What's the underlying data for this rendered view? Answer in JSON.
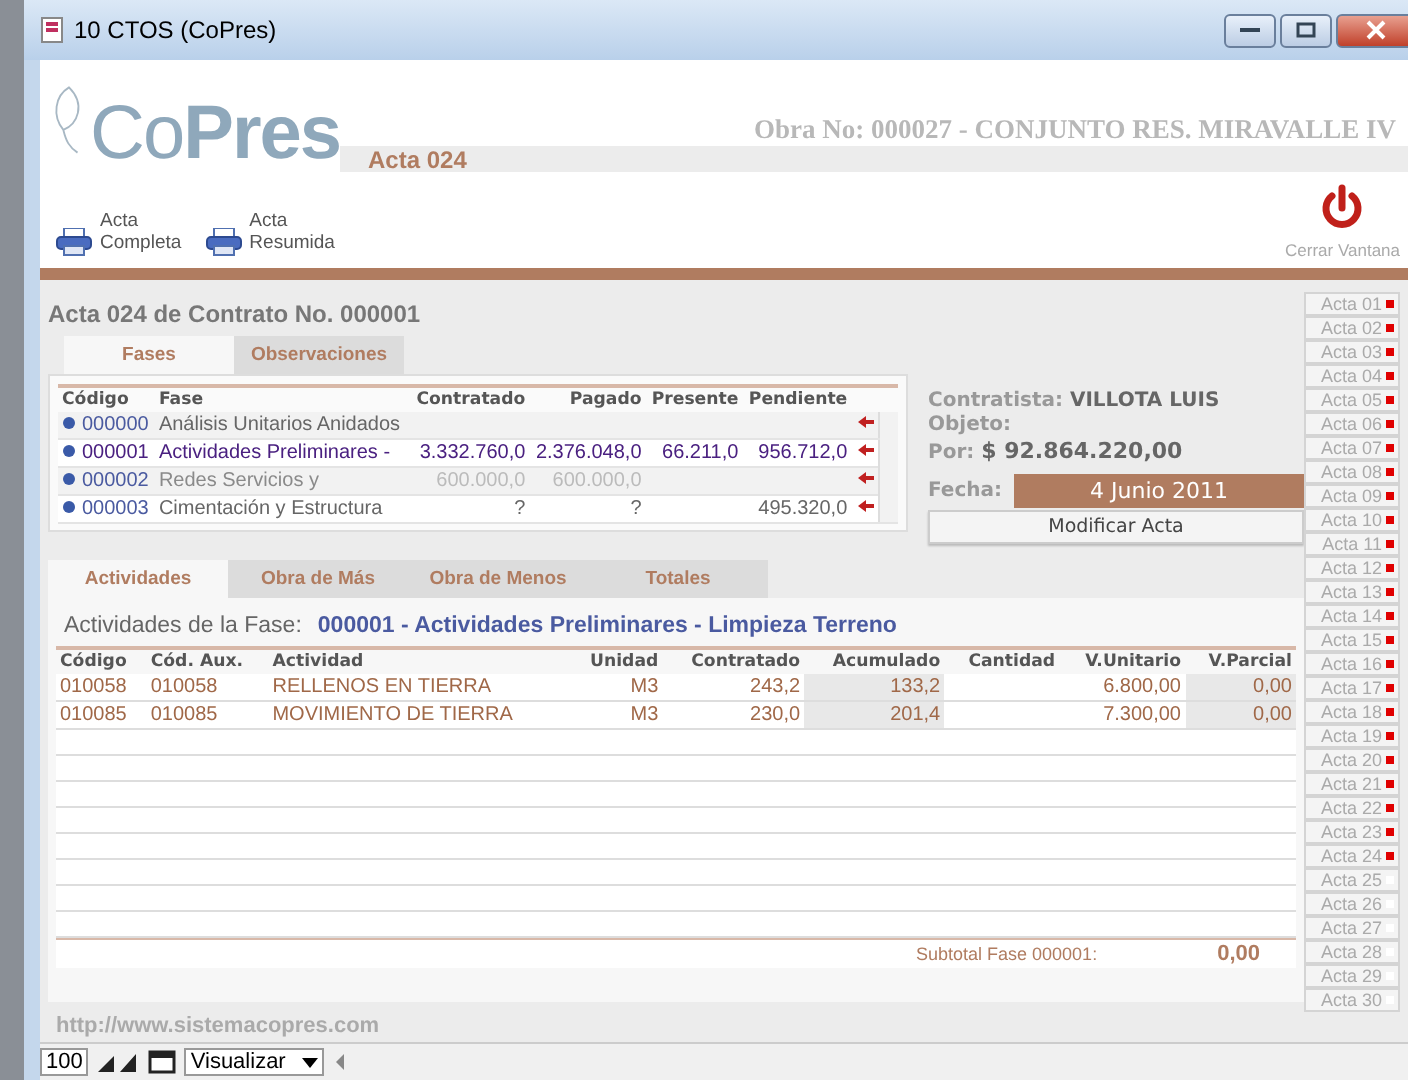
{
  "window": {
    "title": "10 CTOS (CoPres)"
  },
  "header": {
    "logo": "Co**Pres**",
    "acta": "Acta 024",
    "obra": "Obra No: 000027 - CONJUNTO RES. MIRAVALLE IV",
    "print_buttons": [
      {
        "line1": "Acta",
        "line2": "Completa"
      },
      {
        "line1": "Acta",
        "line2": "Resumida"
      }
    ],
    "close_label": "Cerrar Vantana"
  },
  "contract_title": "Acta 024 de Contrato No. 000001",
  "top_tabs": [
    {
      "label": "Fases",
      "selected": true
    },
    {
      "label": "Observaciones",
      "selected": false
    }
  ],
  "fases": {
    "columns": [
      "Código",
      "Fase",
      "Contratado",
      "Pagado",
      "Presente",
      "Pendiente"
    ],
    "rows": [
      {
        "codigo": "000000",
        "fase": "Análisis Unitarios Anidados",
        "contratado": "",
        "pagado": "",
        "presente": "",
        "pendiente": "",
        "selected": false,
        "muted": false
      },
      {
        "codigo": "000001",
        "fase": "Actividades Preliminares -",
        "contratado": "3.332.760,0",
        "pagado": "2.376.048,0",
        "presente": "66.211,0",
        "pendiente": "956.712,0",
        "selected": true,
        "muted": false
      },
      {
        "codigo": "000002",
        "fase": "Redes Servicios y",
        "contratado": "600.000,0",
        "pagado": "600.000,0",
        "presente": "",
        "pendiente": "",
        "selected": false,
        "muted": true
      },
      {
        "codigo": "000003",
        "fase": "Cimentación y Estructura",
        "contratado": "?",
        "pagado": "?",
        "presente": "",
        "pendiente": "495.320,0",
        "selected": false,
        "muted": false
      }
    ]
  },
  "info": {
    "contratista_label": "Contratista:",
    "contratista": "VILLOTA LUIS",
    "objeto_label": "Objeto:",
    "por_label": "Por:",
    "por": "$ 92.864.220,00",
    "fecha_label": "Fecha:",
    "fecha": "4 Junio 2011",
    "button": "Modificar Acta"
  },
  "bottom_tabs": [
    {
      "label": "Actividades",
      "selected": true
    },
    {
      "label": "Obra de Más",
      "selected": false
    },
    {
      "label": "Obra de Menos",
      "selected": false
    },
    {
      "label": "Totales",
      "selected": false
    }
  ],
  "fase_caption": {
    "label": "Actividades de la Fase:",
    "value": "000001 - Actividades Preliminares - Limpieza Terreno"
  },
  "actividades": {
    "columns": [
      "Código",
      "Cód. Aux.",
      "Actividad",
      "Unidad",
      "Contratado",
      "Acumulado",
      "Cantidad",
      "V.Unitario",
      "V.Parcial"
    ],
    "rows": [
      {
        "codigo": "010058",
        "aux": "010058",
        "actividad": "RELLENOS EN TIERRA",
        "unidad": "M3",
        "contratado": "243,2",
        "acumulado": "133,2",
        "cantidad": "",
        "unitario": "6.800,00",
        "parcial": "0,00"
      },
      {
        "codigo": "010085",
        "aux": "010085",
        "actividad": "MOVIMIENTO DE TIERRA",
        "unidad": "M3",
        "contratado": "230,0",
        "acumulado": "201,4",
        "cantidad": "",
        "unitario": "7.300,00",
        "parcial": "0,00"
      }
    ]
  },
  "subtotal": {
    "label": "Subtotal Fase 000001:",
    "value": "0,00"
  },
  "actas": [
    {
      "label": "Acta 01",
      "flagged": true
    },
    {
      "label": "Acta 02",
      "flagged": true
    },
    {
      "label": "Acta 03",
      "flagged": true
    },
    {
      "label": "Acta 04",
      "flagged": true
    },
    {
      "label": "Acta 05",
      "flagged": true
    },
    {
      "label": "Acta 06",
      "flagged": true
    },
    {
      "label": "Acta 07",
      "flagged": true
    },
    {
      "label": "Acta 08",
      "flagged": true
    },
    {
      "label": "Acta 09",
      "flagged": true
    },
    {
      "label": "Acta 10",
      "flagged": true
    },
    {
      "label": "Acta 11",
      "flagged": true
    },
    {
      "label": "Acta 12",
      "flagged": true
    },
    {
      "label": "Acta 13",
      "flagged": true
    },
    {
      "label": "Acta 14",
      "flagged": true
    },
    {
      "label": "Acta 15",
      "flagged": true
    },
    {
      "label": "Acta 16",
      "flagged": true
    },
    {
      "label": "Acta 17",
      "flagged": true
    },
    {
      "label": "Acta 18",
      "flagged": true
    },
    {
      "label": "Acta 19",
      "flagged": true
    },
    {
      "label": "Acta 20",
      "flagged": true
    },
    {
      "label": "Acta 21",
      "flagged": true
    },
    {
      "label": "Acta 22",
      "flagged": true
    },
    {
      "label": "Acta 23",
      "flagged": true
    },
    {
      "label": "Acta 24",
      "flagged": true
    },
    {
      "label": "Acta 25",
      "flagged": false
    },
    {
      "label": "Acta 26",
      "flagged": false
    },
    {
      "label": "Acta 27",
      "flagged": false
    },
    {
      "label": "Acta 28",
      "flagged": false
    },
    {
      "label": "Acta 29",
      "flagged": false
    },
    {
      "label": "Acta 30",
      "flagged": false
    }
  ],
  "url": "http://www.sistemacopres.com",
  "toolbar": {
    "zoom": "100",
    "view": "Visualizar"
  }
}
